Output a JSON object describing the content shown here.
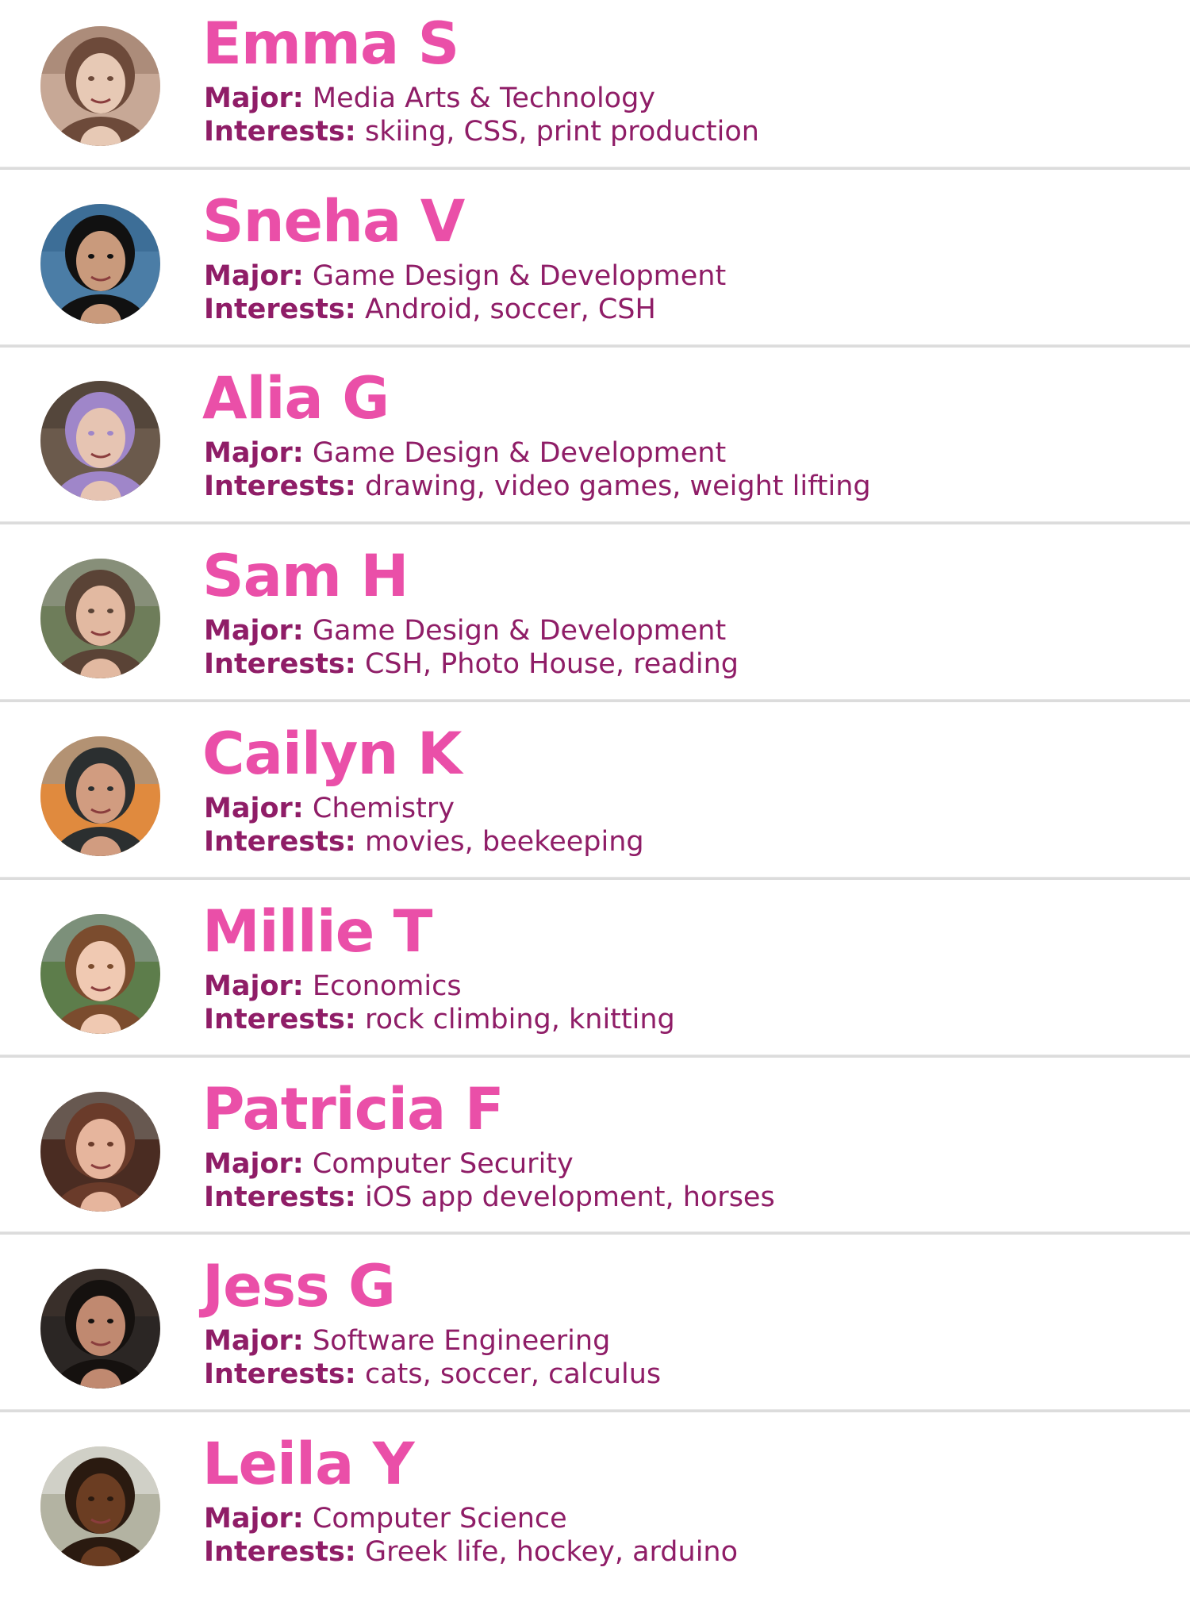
{
  "colors": {
    "name": "#ea4fa8",
    "label": "#8f1d67",
    "value": "#8f1d67",
    "divider": "#dcdcdc"
  },
  "labels": {
    "major": "Major:",
    "interests": "Interests:"
  },
  "members": [
    {
      "name": "Emma S",
      "major": "Media Arts & Technology",
      "interests": "skiing, CSS, print production",
      "avatar_icon": "portrait-photo-icon",
      "avatar_palette": [
        "#c7a896",
        "#6d4a3a",
        "#e7c9b5",
        "#8c6a58"
      ]
    },
    {
      "name": "Sneha V",
      "major": "Game Design & Development",
      "interests": "Android, soccer, CSH",
      "avatar_icon": "portrait-photo-icon",
      "avatar_palette": [
        "#4b7da6",
        "#111111",
        "#c99a7c",
        "#2c5d86"
      ]
    },
    {
      "name": "Alia G",
      "major": "Game Design & Development",
      "interests": "drawing, video games, weight lifting",
      "avatar_icon": "portrait-photo-icon",
      "avatar_palette": [
        "#6b5a4c",
        "#9f86c9",
        "#e6c4b2",
        "#3a2e28"
      ]
    },
    {
      "name": "Sam H",
      "major": "Game Design & Development",
      "interests": "CSH, Photo House, reading",
      "avatar_icon": "portrait-photo-icon",
      "avatar_palette": [
        "#6e7d5a",
        "#5a4336",
        "#e2b9a1",
        "#a6a6a0"
      ]
    },
    {
      "name": "Cailyn K",
      "major": "Chemistry",
      "interests": "movies, beekeeping",
      "avatar_icon": "portrait-photo-icon",
      "avatar_palette": [
        "#e08a3e",
        "#2b2f30",
        "#d19c80",
        "#7d9bb3"
      ]
    },
    {
      "name": "Millie T",
      "major": "Economics",
      "interests": "rock climbing, knitting",
      "avatar_icon": "portrait-photo-icon",
      "avatar_palette": [
        "#5d7d4b",
        "#7b4c2e",
        "#f0c9b2",
        "#a2a8b3"
      ]
    },
    {
      "name": "Patricia F",
      "major": "Computer Security",
      "interests": "iOS app development, horses",
      "avatar_icon": "portrait-photo-icon",
      "avatar_palette": [
        "#4a2c22",
        "#6a3b2a",
        "#e6b59d",
        "#8b8f8a"
      ]
    },
    {
      "name": "Jess G",
      "major": "Software Engineering",
      "interests": "cats, soccer, calculus",
      "avatar_icon": "portrait-photo-icon",
      "avatar_palette": [
        "#2b2624",
        "#15110f",
        "#c08970",
        "#4c3b33"
      ]
    },
    {
      "name": "Leila Y",
      "major": "Computer Science",
      "interests": "Greek life, hockey, arduino",
      "avatar_icon": "portrait-photo-icon",
      "avatar_palette": [
        "#b3b3a2",
        "#2a1a10",
        "#6b3d22",
        "#f4f4f4"
      ]
    }
  ]
}
